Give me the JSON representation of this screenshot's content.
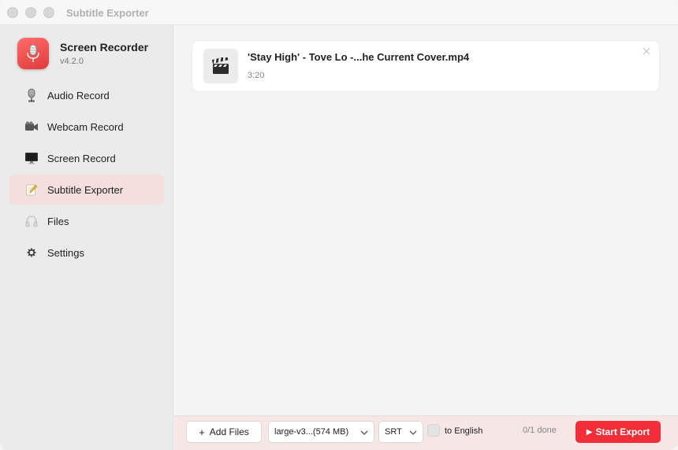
{
  "window": {
    "title": "Subtitle Exporter"
  },
  "app": {
    "name": "Screen Recorder",
    "version": "v4.2.0",
    "logo_icon": "microphone-icon",
    "accent_color": "#f22f38"
  },
  "sidebar": {
    "items": [
      {
        "label": "Audio Record",
        "icon": "microphone-icon",
        "active": false
      },
      {
        "label": "Webcam Record",
        "icon": "video-camera-icon",
        "active": false
      },
      {
        "label": "Screen Record",
        "icon": "monitor-icon",
        "active": false
      },
      {
        "label": "Subtitle Exporter",
        "icon": "notepad-icon",
        "active": true
      },
      {
        "label": "Files",
        "icon": "headphones-icon",
        "active": false
      },
      {
        "label": "Settings",
        "icon": "gear-icon",
        "active": false
      }
    ]
  },
  "files": [
    {
      "name": "'Stay High' - Tove Lo -...he Current Cover.mp4",
      "duration": "3:20",
      "icon": "clapperboard-icon"
    }
  ],
  "bottombar": {
    "add_files_label": "Add Files",
    "model_selected": "large-v3...(574 MB)",
    "format_selected": "SRT",
    "translate_checked": false,
    "translate_label": "to English",
    "progress_text": "0/1 done",
    "start_export_label": "Start Export"
  }
}
